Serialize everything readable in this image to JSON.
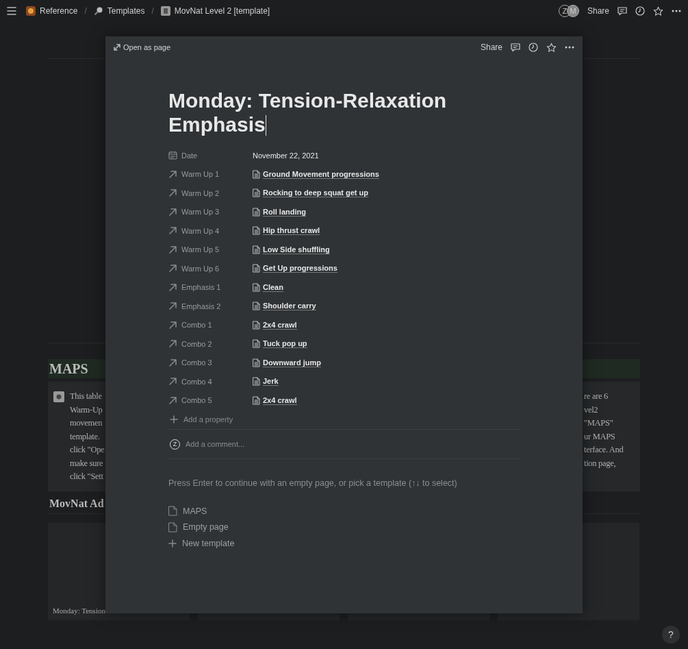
{
  "top_bar": {
    "breadcrumbs": [
      {
        "label": "Reference"
      },
      {
        "label": "Templates"
      },
      {
        "label": "MovNat Level 2 [template]"
      }
    ],
    "separator": "/",
    "avatars": [
      "Z",
      "M"
    ],
    "share": "Share"
  },
  "background": {
    "maps_heading": "MAPS",
    "callout_left": [
      "This table",
      "Warm-Up",
      "movemen",
      "template.",
      "click \"Ope",
      "make sure",
      "click \"Sett"
    ],
    "callout_right": [
      "re are 6",
      "vel2",
      "\"MAPS\"",
      "ur MAPS",
      "terface. And",
      "tion page,"
    ],
    "section_heading": "MovNat Ad",
    "cards": [
      {
        "kind": "captioned",
        "caption": "Monday: Tension"
      },
      {
        "kind": "blank"
      },
      {
        "kind": "blank"
      },
      {
        "kind": "blank"
      }
    ]
  },
  "help": "?",
  "modal": {
    "open_as_page": "Open as page",
    "share": "Share",
    "title": "Monday: Tension-Relaxation Emphasis",
    "properties": [
      {
        "kind": "date",
        "label": "Date",
        "value": "November 22, 2021"
      },
      {
        "kind": "relation",
        "label": "Warm Up 1",
        "value": "Ground Movement progressions"
      },
      {
        "kind": "relation",
        "label": "Warm Up 2",
        "value": "Rocking to deep squat get up"
      },
      {
        "kind": "relation",
        "label": "Warm Up 3",
        "value": "Roll landing"
      },
      {
        "kind": "relation",
        "label": "Warm Up 4",
        "value": "Hip thrust crawl"
      },
      {
        "kind": "relation",
        "label": "Warm Up 5",
        "value": "Low Side shuffling"
      },
      {
        "kind": "relation",
        "label": "Warm Up 6",
        "value": "Get Up progressions"
      },
      {
        "kind": "relation",
        "label": "Emphasis 1",
        "value": "Clean"
      },
      {
        "kind": "relation",
        "label": "Emphasis 2",
        "value": "Shoulder carry"
      },
      {
        "kind": "relation",
        "label": "Combo 1",
        "value": "2x4 crawl"
      },
      {
        "kind": "relation",
        "label": "Combo 2",
        "value": "Tuck pop up"
      },
      {
        "kind": "relation",
        "label": "Combo 3",
        "value": "Downward jump"
      },
      {
        "kind": "relation",
        "label": "Combo 4",
        "value": "Jerk"
      },
      {
        "kind": "relation",
        "label": "Combo 5",
        "value": "2x4 crawl"
      }
    ],
    "add_property": "Add a property",
    "comment_avatar": "Z",
    "comment_placeholder": "Add a comment...",
    "hint": "Press Enter to continue with an empty page, or pick a template (↑↓ to select)",
    "templates": [
      {
        "kind": "page",
        "label": "MAPS"
      },
      {
        "kind": "page",
        "label": "Empty page"
      },
      {
        "kind": "new",
        "label": "New template"
      }
    ]
  }
}
